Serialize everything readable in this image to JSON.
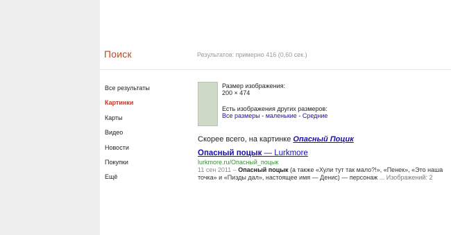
{
  "header": {
    "search_label": "Поиск",
    "stats": "Результатов: примерно 416 (0,60 сек.)"
  },
  "sidebar": {
    "items": [
      {
        "label": "Все результаты",
        "active": false
      },
      {
        "label": "Картинки",
        "active": true
      },
      {
        "label": "Карты",
        "active": false
      },
      {
        "label": "Видео",
        "active": false
      },
      {
        "label": "Новости",
        "active": false
      },
      {
        "label": "Покупки",
        "active": false
      },
      {
        "label": "Ещё",
        "active": false
      }
    ]
  },
  "image_info": {
    "size_label": "Размер изображения:",
    "size_value": "200 × 474",
    "other_sizes_label": "Есть изображения других размеров:",
    "link_all": "Все размеры",
    "link_small": "маленькие",
    "link_medium": "Средние",
    "sep": " - "
  },
  "best_guess": {
    "prefix": "Скорее всего, на картинке ",
    "query": "Опасный Поцик"
  },
  "result": {
    "title_bold": "Опасный поцык",
    "title_rest": " — Lurkmore",
    "url": "lurkmore.ru/Опасный_поцык",
    "date": "11 сен 2011 – ",
    "snippet_bold": "Опасный поцык",
    "snippet_line1_rest": " (а также «Хули тут так мало?!», «Пенек», «Это наша",
    "snippet_line2": "точка» и «Пизды дал», настоящее имя — Денис) — персонаж ",
    "more": "... Изображений: 2"
  }
}
